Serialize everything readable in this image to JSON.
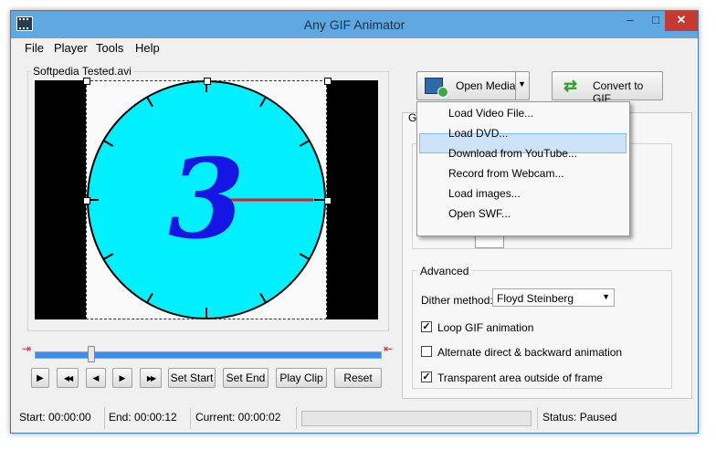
{
  "window": {
    "title": "Any GIF Animator",
    "minimize": "–",
    "maximize": "□",
    "close": "✕"
  },
  "menu": [
    "File",
    "Player",
    "Tools",
    "Help"
  ],
  "preview": {
    "filename": "Softpedia Tested.avi",
    "digit": "3"
  },
  "player_buttons": {
    "play": "▶",
    "rewind": "◀◀",
    "prev": "◀",
    "next": "▶",
    "forward": "▶▶",
    "set_start": "Set Start",
    "set_end": "Set End",
    "play_clip": "Play Clip",
    "reset": "Reset"
  },
  "toolbar": {
    "open_media": "Open Media",
    "convert": "Convert to GIF"
  },
  "dropdown": [
    "Load Video File...",
    "Load DVD...",
    "Download from YouTube...",
    "Record from Webcam...",
    "Load images...",
    "Open SWF..."
  ],
  "dropdown_highlighted_index": 1,
  "panel": {
    "tab_fragment": "G",
    "advanced_title": "Advanced",
    "dither_label": "Dither method:",
    "dither_value": "Floyd Steinberg",
    "loop_label": "Loop GIF animation",
    "loop_checked": true,
    "alternate_label": "Alternate direct & backward animation",
    "alternate_checked": false,
    "transparent_label": "Transparent area outside of frame",
    "transparent_checked": true
  },
  "status": {
    "start": "Start: 00:00:00",
    "end": "End: 00:00:12",
    "current": "Current: 00:00:02",
    "state": "Status: Paused"
  },
  "slider_position": 0.17,
  "colors": {
    "clock_face": "#00f0ff",
    "digit": "#1515e6",
    "hand": "#e01b1b",
    "title_bar": "#5fa8e0",
    "close": "#c7382e",
    "slider": "#3d8ee8"
  }
}
